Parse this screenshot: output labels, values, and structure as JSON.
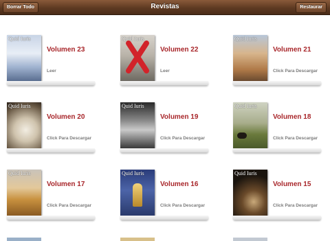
{
  "header": {
    "title": "Revistas",
    "left_button": "Borrar Todo",
    "right_button": "Restaurar"
  },
  "cover": {
    "masthead": "Quid Iuris"
  },
  "items": [
    {
      "title": "Volumen 23",
      "action": "Leer"
    },
    {
      "title": "Volumen 22",
      "action": "Leer"
    },
    {
      "title": "Volumen 21",
      "action": "Click Para Descargar"
    },
    {
      "title": "Volumen 20",
      "action": "Click Para Descargar"
    },
    {
      "title": "Volumen 19",
      "action": "Click Para Descargar"
    },
    {
      "title": "Volumen 18",
      "action": "Click Para Descargar"
    },
    {
      "title": "Volumen 17",
      "action": "Click Para Descargar"
    },
    {
      "title": "Volumen 16",
      "action": "Click Para Descargar"
    },
    {
      "title": "Volumen 15",
      "action": "Click Para Descargar"
    }
  ],
  "colors": {
    "title_red": "#a8262a",
    "nav_brown": "#5e3a22"
  }
}
